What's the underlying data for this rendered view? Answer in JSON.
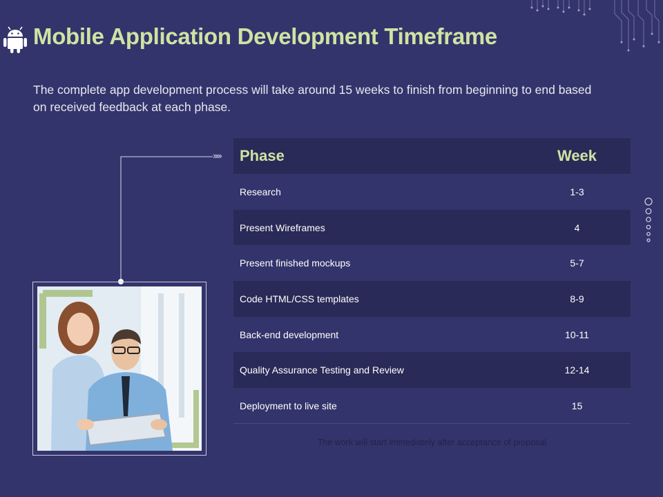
{
  "header": {
    "title": "Mobile Application  Development Timeframe",
    "description": "The complete app development process will take around 15 weeks to finish from beginning to end based on received feedback at each phase."
  },
  "connector": {
    "arrows": "›››››"
  },
  "table": {
    "columns": [
      "Phase",
      "Week"
    ],
    "rows": [
      {
        "phase": "Research",
        "week": "1-3"
      },
      {
        "phase": "Present Wireframes",
        "week": "4"
      },
      {
        "phase": "Present finished mockups",
        "week": "5-7"
      },
      {
        "phase": "Code HTML/CSS templates",
        "week": "8-9"
      },
      {
        "phase": "Back-end development",
        "week": "10-11"
      },
      {
        "phase": "Quality  Assurance Testing and Review",
        "week": "12-14"
      },
      {
        "phase": "Deployment to live site",
        "week": "15"
      }
    ]
  },
  "footnote": "The work will start  immediately  after acceptance of proposal",
  "colors": {
    "background": "#34346c",
    "row_dark": "#2a2a58",
    "accent_title": "#cfe3a3"
  },
  "icons": [
    "android-icon",
    "circuit-decoration",
    "arrow-chevrons",
    "pagination-dots"
  ]
}
